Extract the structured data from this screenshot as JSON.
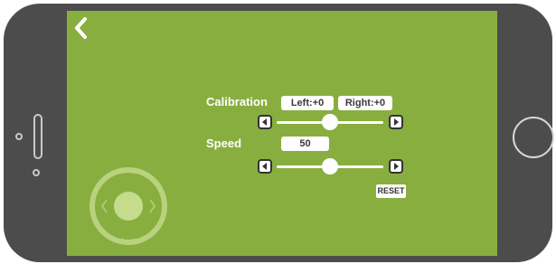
{
  "colors": {
    "phone_body": "#4c4c4c",
    "screen_background": "#88ae40",
    "control_white": "#ffffff"
  },
  "nav": {
    "back_icon": "chevron-left-icon"
  },
  "calibration": {
    "label": "Calibration",
    "left_value": "Left:+0",
    "right_value": "Right:+0",
    "slider_level": 0.5,
    "decrease_icon": "arrow-left-icon",
    "increase_icon": "arrow-right-icon"
  },
  "speed": {
    "label": "Speed",
    "value": "50",
    "slider_level": 0.5,
    "decrease_icon": "arrow-left-icon",
    "increase_icon": "arrow-right-icon"
  },
  "reset": {
    "label": "RESET"
  },
  "joystick": {
    "icon": "joystick-icon"
  }
}
